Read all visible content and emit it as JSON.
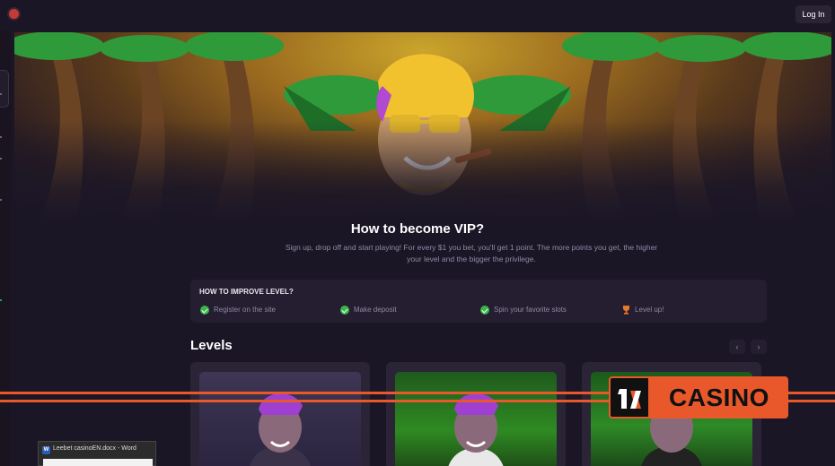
{
  "header": {
    "login_label": "Log In"
  },
  "hero": {
    "title": "How to become VIP?",
    "description": "Sign up, drop off and start playing! For every $1 you bet, you'll get 1 point. The more points you get, the higher your level and the bigger the privilege."
  },
  "improve": {
    "title": "HOW TO IMPROVE LEVEL?",
    "steps": [
      {
        "label": "Register on the site",
        "icon": "check-icon"
      },
      {
        "label": "Make deposit",
        "icon": "check-icon"
      },
      {
        "label": "Spin your favorite slots",
        "icon": "check-icon"
      },
      {
        "label": "Level up!",
        "icon": "trophy-icon"
      }
    ]
  },
  "levels": {
    "title": "Levels",
    "prev_label": "‹",
    "next_label": "›"
  },
  "overlay": {
    "logo_mark": "1x",
    "logo_text": "CASINO"
  },
  "taskbar_popup": {
    "label": "Leebet casinoEN.docx - Word",
    "app_icon": "W"
  },
  "colors": {
    "background": "#1b1626",
    "panel": "#241e30",
    "accent_orange": "#e8582a",
    "check_green": "#3bb54a",
    "muted_text": "#8f8aa3"
  }
}
